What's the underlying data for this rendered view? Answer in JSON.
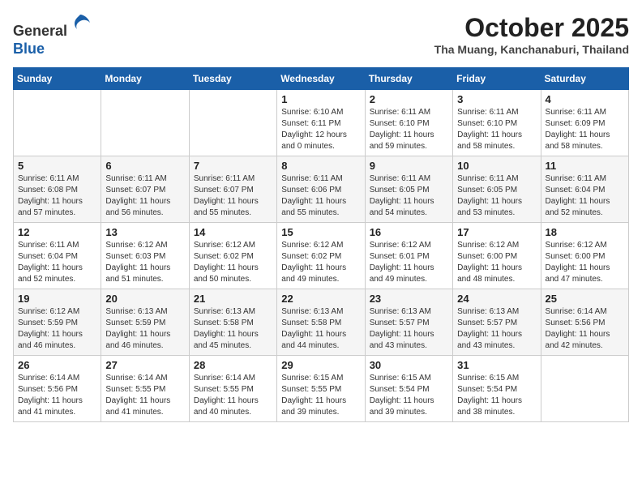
{
  "header": {
    "logo_line1": "General",
    "logo_line2": "Blue",
    "month": "October 2025",
    "location": "Tha Muang, Kanchanaburi, Thailand"
  },
  "days_of_week": [
    "Sunday",
    "Monday",
    "Tuesday",
    "Wednesday",
    "Thursday",
    "Friday",
    "Saturday"
  ],
  "weeks": [
    [
      {
        "day": "",
        "info": ""
      },
      {
        "day": "",
        "info": ""
      },
      {
        "day": "",
        "info": ""
      },
      {
        "day": "1",
        "info": "Sunrise: 6:10 AM\nSunset: 6:11 PM\nDaylight: 12 hours\nand 0 minutes."
      },
      {
        "day": "2",
        "info": "Sunrise: 6:11 AM\nSunset: 6:10 PM\nDaylight: 11 hours\nand 59 minutes."
      },
      {
        "day": "3",
        "info": "Sunrise: 6:11 AM\nSunset: 6:10 PM\nDaylight: 11 hours\nand 58 minutes."
      },
      {
        "day": "4",
        "info": "Sunrise: 6:11 AM\nSunset: 6:09 PM\nDaylight: 11 hours\nand 58 minutes."
      }
    ],
    [
      {
        "day": "5",
        "info": "Sunrise: 6:11 AM\nSunset: 6:08 PM\nDaylight: 11 hours\nand 57 minutes."
      },
      {
        "day": "6",
        "info": "Sunrise: 6:11 AM\nSunset: 6:07 PM\nDaylight: 11 hours\nand 56 minutes."
      },
      {
        "day": "7",
        "info": "Sunrise: 6:11 AM\nSunset: 6:07 PM\nDaylight: 11 hours\nand 55 minutes."
      },
      {
        "day": "8",
        "info": "Sunrise: 6:11 AM\nSunset: 6:06 PM\nDaylight: 11 hours\nand 55 minutes."
      },
      {
        "day": "9",
        "info": "Sunrise: 6:11 AM\nSunset: 6:05 PM\nDaylight: 11 hours\nand 54 minutes."
      },
      {
        "day": "10",
        "info": "Sunrise: 6:11 AM\nSunset: 6:05 PM\nDaylight: 11 hours\nand 53 minutes."
      },
      {
        "day": "11",
        "info": "Sunrise: 6:11 AM\nSunset: 6:04 PM\nDaylight: 11 hours\nand 52 minutes."
      }
    ],
    [
      {
        "day": "12",
        "info": "Sunrise: 6:11 AM\nSunset: 6:04 PM\nDaylight: 11 hours\nand 52 minutes."
      },
      {
        "day": "13",
        "info": "Sunrise: 6:12 AM\nSunset: 6:03 PM\nDaylight: 11 hours\nand 51 minutes."
      },
      {
        "day": "14",
        "info": "Sunrise: 6:12 AM\nSunset: 6:02 PM\nDaylight: 11 hours\nand 50 minutes."
      },
      {
        "day": "15",
        "info": "Sunrise: 6:12 AM\nSunset: 6:02 PM\nDaylight: 11 hours\nand 49 minutes."
      },
      {
        "day": "16",
        "info": "Sunrise: 6:12 AM\nSunset: 6:01 PM\nDaylight: 11 hours\nand 49 minutes."
      },
      {
        "day": "17",
        "info": "Sunrise: 6:12 AM\nSunset: 6:00 PM\nDaylight: 11 hours\nand 48 minutes."
      },
      {
        "day": "18",
        "info": "Sunrise: 6:12 AM\nSunset: 6:00 PM\nDaylight: 11 hours\nand 47 minutes."
      }
    ],
    [
      {
        "day": "19",
        "info": "Sunrise: 6:12 AM\nSunset: 5:59 PM\nDaylight: 11 hours\nand 46 minutes."
      },
      {
        "day": "20",
        "info": "Sunrise: 6:13 AM\nSunset: 5:59 PM\nDaylight: 11 hours\nand 46 minutes."
      },
      {
        "day": "21",
        "info": "Sunrise: 6:13 AM\nSunset: 5:58 PM\nDaylight: 11 hours\nand 45 minutes."
      },
      {
        "day": "22",
        "info": "Sunrise: 6:13 AM\nSunset: 5:58 PM\nDaylight: 11 hours\nand 44 minutes."
      },
      {
        "day": "23",
        "info": "Sunrise: 6:13 AM\nSunset: 5:57 PM\nDaylight: 11 hours\nand 43 minutes."
      },
      {
        "day": "24",
        "info": "Sunrise: 6:13 AM\nSunset: 5:57 PM\nDaylight: 11 hours\nand 43 minutes."
      },
      {
        "day": "25",
        "info": "Sunrise: 6:14 AM\nSunset: 5:56 PM\nDaylight: 11 hours\nand 42 minutes."
      }
    ],
    [
      {
        "day": "26",
        "info": "Sunrise: 6:14 AM\nSunset: 5:56 PM\nDaylight: 11 hours\nand 41 minutes."
      },
      {
        "day": "27",
        "info": "Sunrise: 6:14 AM\nSunset: 5:55 PM\nDaylight: 11 hours\nand 41 minutes."
      },
      {
        "day": "28",
        "info": "Sunrise: 6:14 AM\nSunset: 5:55 PM\nDaylight: 11 hours\nand 40 minutes."
      },
      {
        "day": "29",
        "info": "Sunrise: 6:15 AM\nSunset: 5:55 PM\nDaylight: 11 hours\nand 39 minutes."
      },
      {
        "day": "30",
        "info": "Sunrise: 6:15 AM\nSunset: 5:54 PM\nDaylight: 11 hours\nand 39 minutes."
      },
      {
        "day": "31",
        "info": "Sunrise: 6:15 AM\nSunset: 5:54 PM\nDaylight: 11 hours\nand 38 minutes."
      },
      {
        "day": "",
        "info": ""
      }
    ]
  ]
}
